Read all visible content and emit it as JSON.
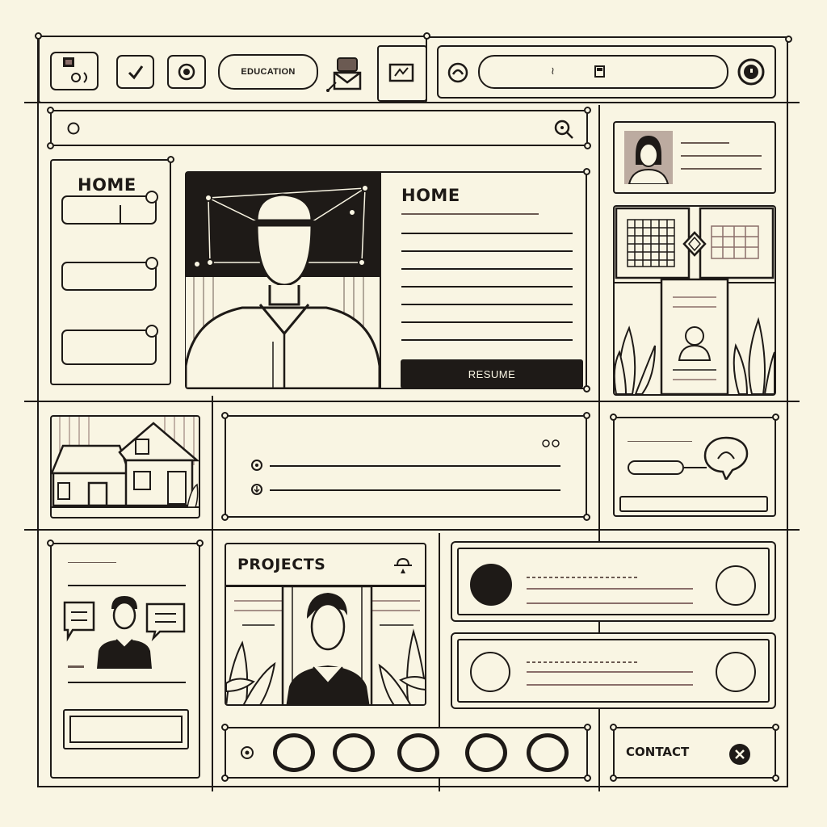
{
  "top_bar": {
    "education_label": "EDUCATION",
    "search_text": "≀",
    "icons": [
      "image-icon",
      "check-icon",
      "record-icon",
      "mail-icon",
      "edit-icon",
      "location-icon",
      "file-icon",
      "power-icon"
    ]
  },
  "sidebar": {
    "title": "HOME"
  },
  "hero": {
    "title": "HOME",
    "resume_label": "RESUME"
  },
  "projects": {
    "title": "PROJECTS"
  },
  "contact": {
    "label": "CONTACT"
  },
  "colors": {
    "ink": "#1e1a17",
    "paper": "#f9f5e3",
    "accent_line": "#8a6e6a"
  }
}
